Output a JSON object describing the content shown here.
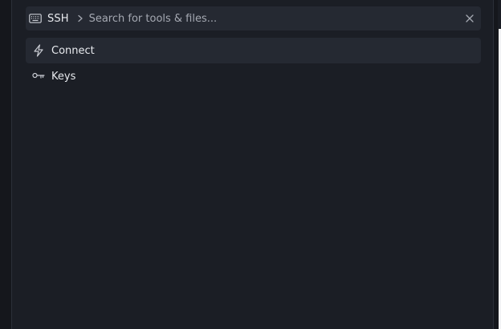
{
  "search": {
    "scope": "SSH",
    "placeholder": "Search for tools & files...",
    "value": "",
    "scope_icon": "keyboard-icon",
    "separator_icon": "chevron-right-icon",
    "clear_icon": "close-icon"
  },
  "results": [
    {
      "label": "Connect",
      "icon": "lightning-icon",
      "active": true
    },
    {
      "label": "Keys",
      "icon": "key-icon",
      "active": false
    }
  ],
  "colors": {
    "background": "#15171d",
    "panel": "#1b1e25",
    "field": "#252932",
    "text": "#e8eaee",
    "muted": "#a5a9b2"
  }
}
